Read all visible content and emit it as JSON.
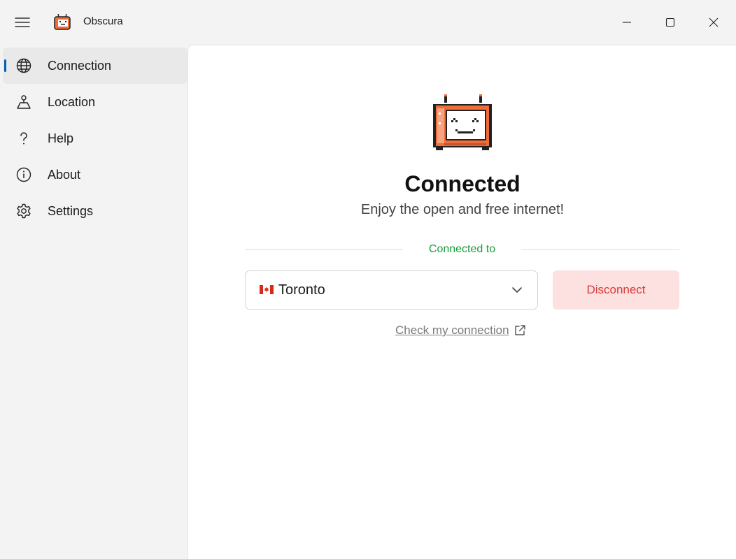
{
  "app": {
    "title": "Obscura",
    "icons": {
      "menu": "hamburger-menu-icon",
      "app": "obscura-tv-logo-icon",
      "minimize": "minimize-icon",
      "maximize": "maximize-icon",
      "close": "close-icon"
    }
  },
  "sidebar": {
    "items": [
      {
        "label": "Connection",
        "icon": "globe-icon",
        "active": true
      },
      {
        "label": "Location",
        "icon": "location-pin-icon",
        "active": false
      },
      {
        "label": "Help",
        "icon": "question-icon",
        "active": false
      },
      {
        "label": "About",
        "icon": "info-icon",
        "active": false
      },
      {
        "label": "Settings",
        "icon": "gear-icon",
        "active": false
      }
    ]
  },
  "main": {
    "status_title": "Connected",
    "status_subtitle": "Enjoy the open and free internet!",
    "connected_to_label": "Connected to",
    "location": {
      "value": "Toronto",
      "flag": "canada-flag-icon"
    },
    "disconnect_label": "Disconnect",
    "check_link_label": "Check my connection"
  },
  "colors": {
    "accent": "#005fb8",
    "connected_green": "#1a9e3a",
    "disconnect_text": "#d93a3a",
    "disconnect_bg": "#fde0e0",
    "logo_orange": "#f26b3a"
  }
}
